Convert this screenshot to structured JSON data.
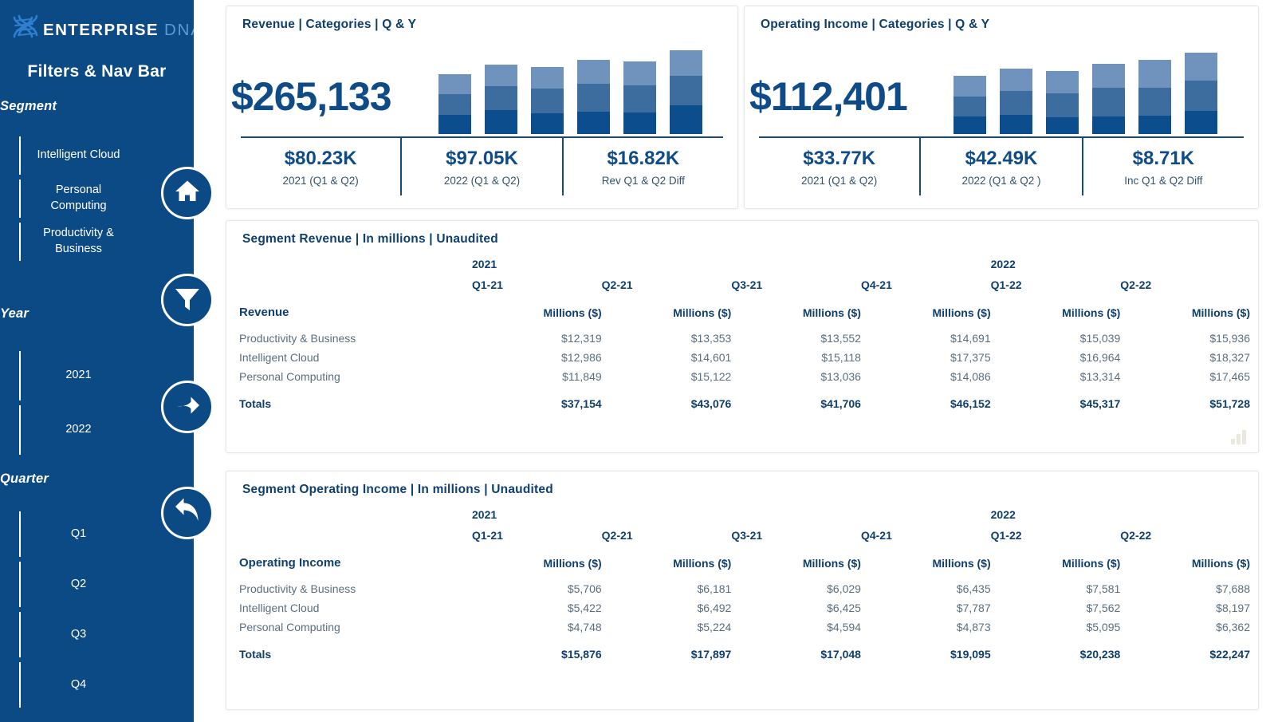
{
  "brand": {
    "name_primary": "ENTERPRISE",
    "name_secondary": "DNA",
    "logo_icon": "dna-helix-icon",
    "sidebar_bg": "#0c4a85",
    "accent_blue": "#0f4c87"
  },
  "sidebar": {
    "title": "Filters & Nav Bar",
    "groups": [
      {
        "label": "Segment",
        "items": [
          "Intelligent Cloud",
          "Personal Computing",
          "Productivity & Business"
        ]
      },
      {
        "label": "Year",
        "items": [
          "2021",
          "2022"
        ]
      },
      {
        "label": "Quarter",
        "items": [
          "Q1",
          "Q2",
          "Q3",
          "Q4"
        ]
      }
    ],
    "nav_buttons": [
      {
        "icon": "home-icon",
        "name": "home"
      },
      {
        "icon": "funnel-filter-icon",
        "name": "filter"
      },
      {
        "icon": "arrow-right-icon",
        "name": "forward"
      },
      {
        "icon": "arrow-back-icon",
        "name": "back"
      }
    ]
  },
  "kpi_cards": [
    {
      "title": "Revenue | Categories | Q & Y",
      "big_value": "$265,133",
      "subs": [
        {
          "value": "$80.23K",
          "label": "2021 (Q1 & Q2)"
        },
        {
          "value": "$97.05K",
          "label": "2022 (Q1 & Q2)"
        },
        {
          "value": "$16.82K",
          "label": "Rev Q1 & Q2 Diff"
        }
      ],
      "chart_data": {
        "type": "bar",
        "title": "Revenue | Categories | Q & Y",
        "categories": [
          "Q1-21",
          "Q2-21",
          "Q3-21",
          "Q4-21",
          "Q1-22",
          "Q2-22"
        ],
        "series": [
          {
            "name": "Personal Computing",
            "color": "#0c4e8d",
            "values": [
              11849,
              15122,
              13036,
              14086,
              13314,
              17465
            ]
          },
          {
            "name": "Intelligent Cloud",
            "color": "#3d6d9e",
            "values": [
              12986,
              14601,
              15118,
              17375,
              16964,
              18327
            ]
          },
          {
            "name": "Productivity & Business",
            "color": "#6f93bc",
            "values": [
              12319,
              13353,
              13552,
              14691,
              15039,
              15936
            ]
          }
        ],
        "totals": [
          37154,
          43076,
          41706,
          46152,
          45317,
          51728
        ],
        "stacked": true,
        "grid": false,
        "legend": "none",
        "xlabel": "",
        "ylabel": "Millions ($)"
      }
    },
    {
      "title": "Operating Income | Categories | Q & Y",
      "big_value": "$112,401",
      "subs": [
        {
          "value": "$33.77K",
          "label": "2021 (Q1 & Q2)"
        },
        {
          "value": "$42.49K",
          "label": "2022 (Q1 & Q2 )"
        },
        {
          "value": "$8.71K",
          "label": "Inc Q1 & Q2 Diff"
        }
      ],
      "chart_data": {
        "type": "bar",
        "title": "Operating Income | Categories | Q & Y",
        "categories": [
          "Q1-21",
          "Q2-21",
          "Q3-21",
          "Q4-21",
          "Q1-22",
          "Q2-22"
        ],
        "series": [
          {
            "name": "Personal Computing",
            "color": "#0c4e8d",
            "values": [
              4748,
              5224,
              4594,
              4873,
              5095,
              6362
            ]
          },
          {
            "name": "Intelligent Cloud",
            "color": "#3d6d9e",
            "values": [
              5422,
              6492,
              6425,
              7787,
              7562,
              8197
            ]
          },
          {
            "name": "Productivity & Business",
            "color": "#6f93bc",
            "values": [
              5706,
              6181,
              6029,
              6435,
              7581,
              7688
            ]
          }
        ],
        "totals": [
          15876,
          17897,
          17048,
          19095,
          20238,
          22247
        ],
        "stacked": true,
        "grid": false,
        "legend": "none",
        "xlabel": "",
        "ylabel": "Millions ($)"
      }
    }
  ],
  "tables": [
    {
      "title": "Segment Revenue | In millions |  Unaudited",
      "year_headers": [
        {
          "label": "2021",
          "col": 1
        },
        {
          "label": "2022",
          "col": 5
        }
      ],
      "quarter_headers": [
        "Q1-21",
        "Q2-21",
        "Q3-21",
        "Q4-21",
        "Q1-22",
        "Q2-22"
      ],
      "row_header_label": "Revenue",
      "unit_headers": [
        "Millions ($)",
        "Millions ($)",
        "Millions ($)",
        "Millions ($)",
        "Millions ($)",
        "Millions ($)"
      ],
      "rows": [
        {
          "name": "Productivity & Business",
          "values": [
            "$12,319",
            "$13,353",
            "$13,552",
            "$14,691",
            "$15,039",
            "$15,936"
          ]
        },
        {
          "name": "Intelligent Cloud",
          "values": [
            "$12,986",
            "$14,601",
            "$15,118",
            "$17,375",
            "$16,964",
            "$18,327"
          ]
        },
        {
          "name": "Personal Computing",
          "values": [
            "$11,849",
            "$15,122",
            "$13,036",
            "$14,086",
            "$13,314",
            "$17,465"
          ]
        }
      ],
      "total_row": {
        "name": "Totals",
        "values": [
          "$37,154",
          "$43,076",
          "$41,706",
          "$46,152",
          "$45,317",
          "$51,728"
        ]
      },
      "corner_icon": "focus-mode-icon"
    },
    {
      "title": "Segment Operating Income | In millions |  Unaudited",
      "year_headers": [
        {
          "label": "2021",
          "col": 1
        },
        {
          "label": "2022",
          "col": 5
        }
      ],
      "quarter_headers": [
        "Q1-21",
        "Q2-21",
        "Q3-21",
        "Q4-21",
        "Q1-22",
        "Q2-22"
      ],
      "row_header_label": "Operating Income",
      "unit_headers": [
        "Millions ($)",
        "Millions ($)",
        "Millions ($)",
        "Millions ($)",
        "Millions ($)",
        "Millions ($)"
      ],
      "rows": [
        {
          "name": "Productivity & Business",
          "values": [
            "$5,706",
            "$6,181",
            "$6,029",
            "$6,435",
            "$7,581",
            "$7,688"
          ]
        },
        {
          "name": "Intelligent Cloud",
          "values": [
            "$5,422",
            "$6,492",
            "$6,425",
            "$7,787",
            "$7,562",
            "$8,197"
          ]
        },
        {
          "name": "Personal Computing",
          "values": [
            "$4,748",
            "$5,224",
            "$4,594",
            "$4,873",
            "$5,095",
            "$6,362"
          ]
        }
      ],
      "total_row": {
        "name": "Totals",
        "values": [
          "$15,876",
          "$17,897",
          "$17,048",
          "$19,095",
          "$20,238",
          "$22,247"
        ]
      },
      "corner_icon": null
    }
  ]
}
